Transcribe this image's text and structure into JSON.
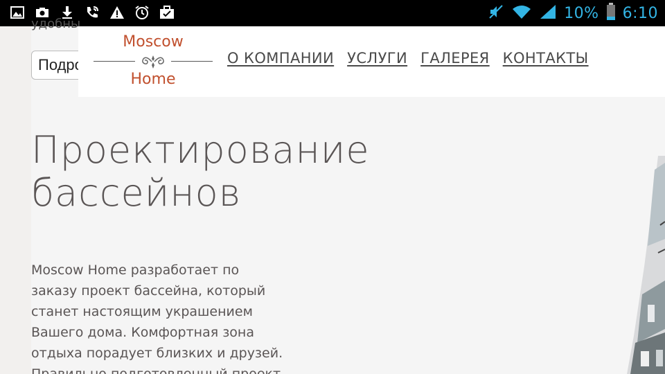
{
  "status_bar": {
    "battery_percent": "10%",
    "time": "6:10",
    "left_icons": [
      "gallery-icon",
      "camera-icon",
      "download-icon",
      "phone-call-icon",
      "warning-icon",
      "alarm-icon",
      "briefcase-check-icon"
    ],
    "right_icons": [
      "mute-icon",
      "wifi-icon",
      "signal-icon",
      "battery-icon"
    ],
    "accent_color": "#33b5e5"
  },
  "behind_header": {
    "partial_text": "удобны",
    "select_value": "Подробнее"
  },
  "header": {
    "logo": {
      "top_text": "Moscow",
      "bottom_text": "Home",
      "color": "#c1502e"
    },
    "nav": [
      "О КОМПАНИИ",
      "УСЛУГИ",
      "ГАЛЕРЕЯ",
      "КОНТАКТЫ"
    ]
  },
  "main": {
    "title_line1": "Проектирование",
    "title_line2": "бассейнов",
    "intro": "Moscow Home разработает по заказу проект бассейна, который станет настоящим украшением Вашего дома. Комфортная зона отдыха порадует близких и друзей. Правильно подготовленный проект"
  }
}
